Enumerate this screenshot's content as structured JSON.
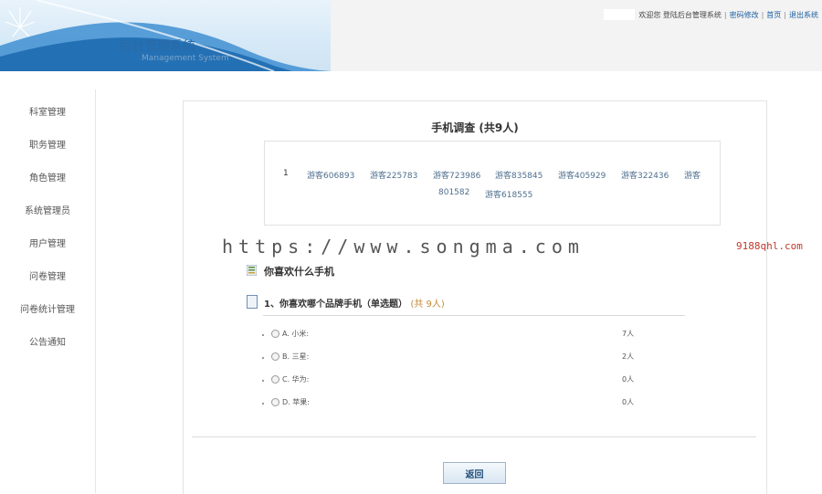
{
  "header": {
    "title": "后台管理系统",
    "subtitle": "Management System",
    "welcome": "欢迎您 登陆后台管理系统",
    "links": [
      "密码修改",
      "首页",
      "退出系统"
    ]
  },
  "sidebar": {
    "items": [
      "科室管理",
      "职务管理",
      "角色管理",
      "系统管理员",
      "用户管理",
      "问卷管理",
      "问卷统计管理",
      "公告通知"
    ]
  },
  "panel": {
    "title": "手机调查 (共9人)",
    "visitor_index": "1",
    "visitors": [
      "游客606893",
      "游客225783",
      "游客723986",
      "游客835845",
      "游客405929",
      "游客322436",
      "游客",
      "801582",
      "游客618555"
    ]
  },
  "watermark": {
    "url": "https://www.songma.com",
    "site": "9188qhl.com"
  },
  "survey": {
    "title": "你喜欢什么手机",
    "question": "1、你喜欢哪个品牌手机（单选题）",
    "question_count": "(共 9人)",
    "options": [
      {
        "label": "A. 小米:",
        "value": "7人"
      },
      {
        "label": "B. 三星:",
        "value": "2人"
      },
      {
        "label": "C. 华为:",
        "value": "0人"
      },
      {
        "label": "D. 苹果:",
        "value": "0人"
      }
    ]
  },
  "actions": {
    "back": "返回"
  }
}
